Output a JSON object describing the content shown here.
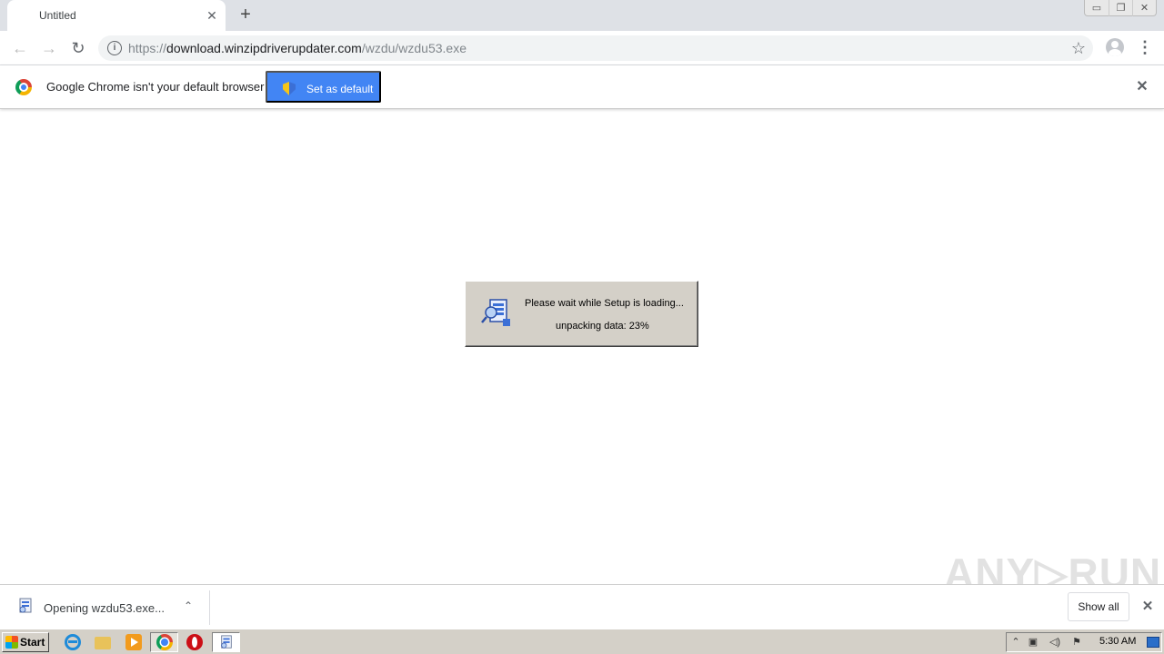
{
  "browser": {
    "tab": {
      "title": "Untitled",
      "close": "✕"
    },
    "new_tab": "+",
    "window_controls": {
      "minimize": "▭",
      "restore": "❐",
      "close": "✕"
    },
    "nav": {
      "back": "←",
      "forward": "→",
      "reload": "↻"
    },
    "address": {
      "scheme": "https://",
      "host": "download.winzipdriverupdater.com",
      "path": "/wzdu/wzdu53.exe",
      "info_glyph": "i",
      "star_glyph": "☆"
    },
    "menu_glyph": "⋮"
  },
  "infobar": {
    "message": "Google Chrome isn't your default browser",
    "button_label": "Set as default",
    "close_glyph": "✕"
  },
  "setup_dialog": {
    "message": "Please wait while Setup is loading...",
    "progress_text": "unpacking data: 23%",
    "progress_percent": 23
  },
  "download_shelf": {
    "item_label": "Opening wzdu53.exe...",
    "chevron_glyph": "⌃",
    "show_all_label": "Show all",
    "close_glyph": "✕",
    "watermark": "ANY▷RUN"
  },
  "taskbar": {
    "start_label": "Start",
    "clock": "5:30 AM",
    "tray_glyphs": {
      "expand": "⌃",
      "network": "▣",
      "volume": "◁)",
      "flag": "⚑"
    }
  },
  "colors": {
    "accent_blue": "#4285f4",
    "dialog_gray": "#d4d0c8",
    "tabstrip": "#dee1e6"
  }
}
